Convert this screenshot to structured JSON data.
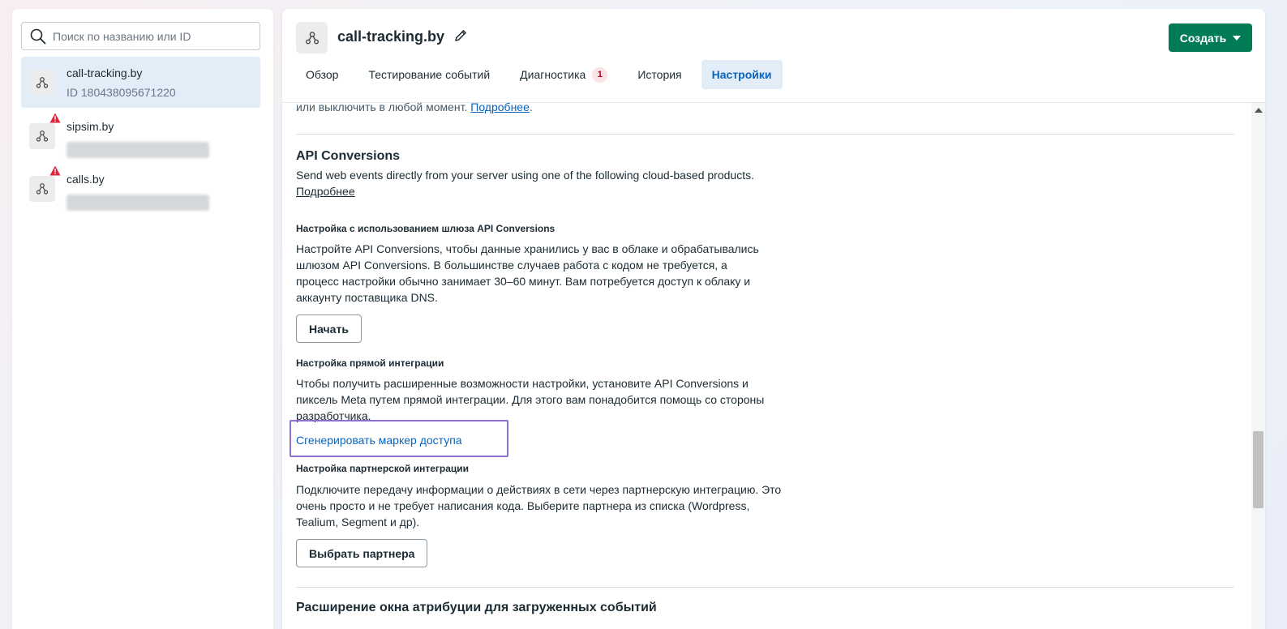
{
  "search": {
    "placeholder": "Поиск по названию или ID"
  },
  "pixels": [
    {
      "name": "call-tracking.by",
      "id": "ID 180438095671220",
      "warning": false,
      "selected": true
    },
    {
      "name": "sipsim.by",
      "warning": true
    },
    {
      "name": "calls.by",
      "warning": true
    }
  ],
  "header": {
    "title": "call-tracking.by",
    "create_label": "Создать"
  },
  "tabs": [
    {
      "label": "Обзор"
    },
    {
      "label": "Тестирование событий"
    },
    {
      "label": "Диагностика",
      "badge": "1"
    },
    {
      "label": "История"
    },
    {
      "label": "Настройки",
      "active": true
    }
  ],
  "content": {
    "top_text": "или выключить в любой момент.",
    "top_link": "Подробнее",
    "api_title": "API Conversions",
    "api_desc": "Send web events directly from your server using one of the following cloud-based products.",
    "api_link": "Подробнее",
    "gateway_title": "Настройка с использованием шлюза API Conversions",
    "gateway_desc": "Настройте API Conversions, чтобы данные хранились у вас в облаке и обрабатывались шлюзом API Conversions. В большинстве случаев работа с кодом не требуется, а процесс настройки обычно занимает 30–60 минут. Вам потребуется доступ к облаку и аккаунту поставщика DNS.",
    "start_button": "Начать",
    "direct_title": "Настройка прямой интеграции",
    "direct_desc": "Чтобы получить расширенные возможности настройки, установите API Conversions и пиксель Meta путем прямой интеграции. Для этого вам понадобится помощь со стороны разработчика.",
    "generate_link": "Сгенерировать маркер доступа",
    "partner_title": "Настройка партнерской интеграции",
    "partner_desc": "Подключите передачу информации о действиях в сети через партнерскую интеграцию. Это очень просто и не требует написания кода. Выберите партнера из списка (Wordpress, Tealium, Segment и др).",
    "partner_button": "Выбрать партнера",
    "attribution_title": "Расширение окна атрибуции для загруженных событий"
  },
  "colors": {
    "accent": "#007b55",
    "link": "#0a63bd",
    "highlight": "#8d6fd1"
  }
}
